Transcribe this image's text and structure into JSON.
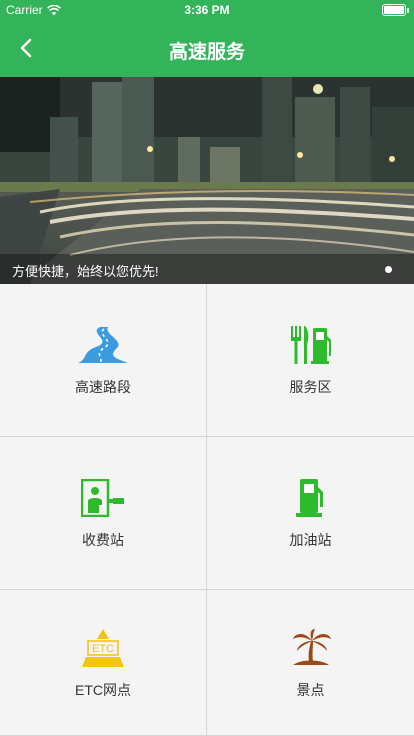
{
  "status_bar": {
    "carrier": "Carrier",
    "time": "3:36 PM",
    "icons": [
      "wifi-icon",
      "battery-icon"
    ]
  },
  "nav": {
    "title": "高速服务",
    "back_icon": "chevron-left-icon"
  },
  "banner": {
    "caption": "方便快捷，始终以您优先!",
    "page_indicator": {
      "current": 1,
      "total": 1
    }
  },
  "services": [
    {
      "label": "高速路段",
      "icon": "winding-road-icon"
    },
    {
      "label": "服务区",
      "icon": "fork-knife-fuel-icon"
    },
    {
      "label": "收费站",
      "icon": "toll-booth-icon"
    },
    {
      "label": "加油站",
      "icon": "fuel-pump-icon"
    },
    {
      "label": "ETC网点",
      "icon": "etc-triangle-icon",
      "icon_text": "ETC"
    },
    {
      "label": "景点",
      "icon": "palm-island-icon"
    }
  ],
  "colors": {
    "brand_green": "#33b35a",
    "icon_green": "#2dbb2d",
    "road_blue": "#3a9be0",
    "etc_yellow": "#f3c414",
    "scenic_brown": "#9a4a15",
    "grid_background": "#f4f4f4"
  }
}
